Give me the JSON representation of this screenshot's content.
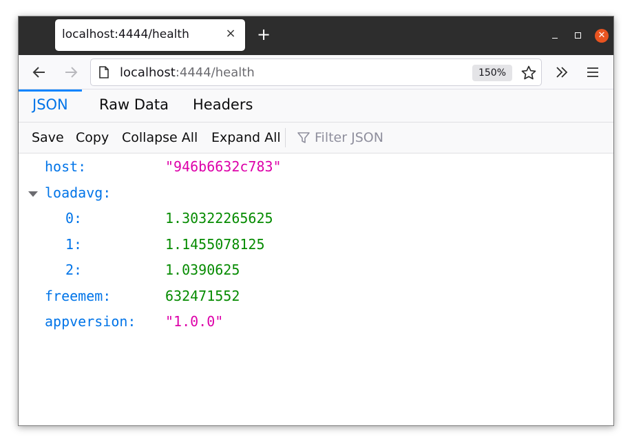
{
  "browser": {
    "tab_title": "localhost:4444/health",
    "close_tab_icon": "×",
    "new_tab_icon": "+",
    "url_host": "localhost",
    "url_rest": ":4444/health",
    "zoom": "150%",
    "accent_color": "#e95420"
  },
  "viewer": {
    "tabs": [
      "JSON",
      "Raw Data",
      "Headers"
    ],
    "active_tab": "JSON",
    "toolbar": {
      "save": "Save",
      "copy": "Copy",
      "collapse_all": "Collapse All",
      "expand_all": "Expand All",
      "filter_placeholder": "Filter JSON"
    }
  },
  "json": {
    "host": {
      "key": "host:",
      "value": "\"946b6632c783\""
    },
    "loadavg": {
      "key": "loadavg:",
      "items": [
        {
          "key": "0:",
          "value": "1.30322265625"
        },
        {
          "key": "1:",
          "value": "1.1455078125"
        },
        {
          "key": "2:",
          "value": "1.0390625"
        }
      ]
    },
    "freemem": {
      "key": "freemem:",
      "value": "632471552"
    },
    "appversion": {
      "key": "appversion:",
      "value": "\"1.0.0\""
    }
  },
  "colors": {
    "key": "#0074e8",
    "string": "#dd00a9",
    "number": "#058b00",
    "active_tab": "#0074e8"
  }
}
